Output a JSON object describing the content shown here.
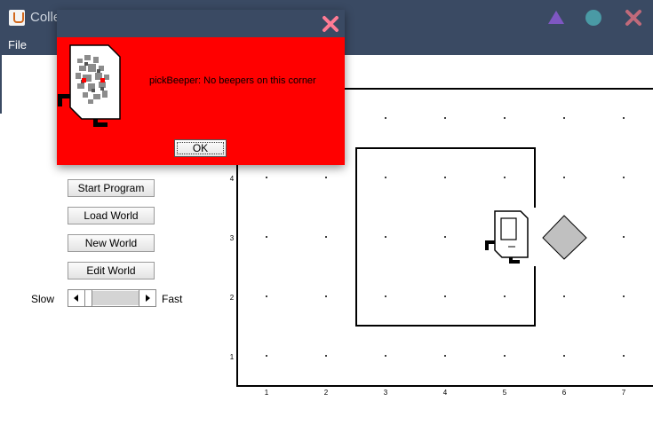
{
  "window": {
    "title": "Colle",
    "controls": {
      "minimize_icon": "triangle-icon",
      "maximize_icon": "circle-icon",
      "close_icon": "x-icon"
    }
  },
  "menu": {
    "file": "File"
  },
  "controls": {
    "start_program": "Start Program",
    "load_world": "Load World",
    "new_world": "New World",
    "edit_world": "Edit World",
    "speed": {
      "slow": "Slow",
      "fast": "Fast",
      "value": 0.0
    }
  },
  "world": {
    "x_labels": [
      "1",
      "2",
      "3",
      "4",
      "5",
      "6",
      "7"
    ],
    "y_labels": [
      "1",
      "2",
      "3",
      "4"
    ],
    "karel": {
      "avenue": 5,
      "street": 3,
      "facing": "east"
    },
    "beeper": {
      "avenue": 6,
      "street": 3
    },
    "walls_room": {
      "from_avenue": 3,
      "to_avenue": 5,
      "from_street": 2,
      "to_street": 4
    }
  },
  "dialog": {
    "message": "pickBeeper: No beepers on this corner",
    "ok_label": "OK",
    "background": "#ff0000",
    "close_icon": "x-icon"
  },
  "colors": {
    "titlebar": "#3a4a63",
    "minimize": "#7e57c2",
    "maximize": "#4a9aa5",
    "close": "#c06a7a",
    "dialog_close": "#ff7b94",
    "beeper": "#c0c0c0"
  }
}
